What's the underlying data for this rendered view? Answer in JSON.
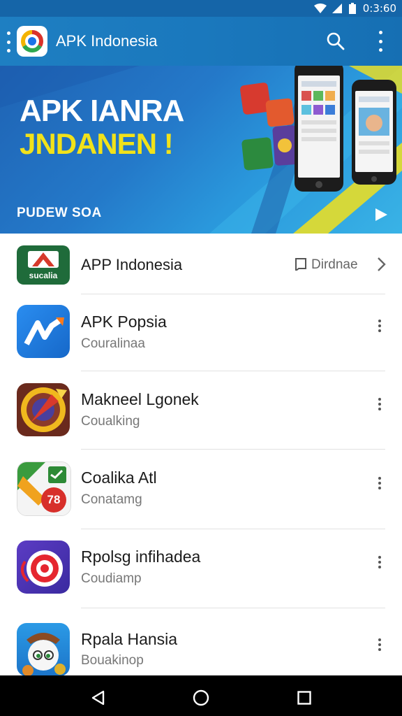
{
  "status_bar": {
    "time": "0:3:60"
  },
  "app_bar": {
    "title": "APK Indonesia"
  },
  "banner": {
    "headline_line1": "APK IANRA",
    "headline_line2": "JNDANEN !",
    "subtitle": "PUDEW SOA"
  },
  "list": {
    "featured": {
      "title": "APP Indonesia",
      "action_label": "Dirdnae"
    },
    "items": [
      {
        "title": "APK Popsia",
        "subtitle": "Couralinaa"
      },
      {
        "title": "Makneel Lgonek",
        "subtitle": "Coualking"
      },
      {
        "title": "Coalika Atl",
        "subtitle": "Conatamg"
      },
      {
        "title": "Rpolsg infihadea",
        "subtitle": "Coudiamp"
      },
      {
        "title": "Rpala Hansia",
        "subtitle": "Bouakinop"
      }
    ]
  },
  "icon_texts": {
    "featured_icon_text": "sucalia",
    "item3_badge": "78"
  },
  "colors": {
    "app_bar": "#1a78bd",
    "status_bar": "#1565a8",
    "banner_accent": "#f1e21a"
  }
}
